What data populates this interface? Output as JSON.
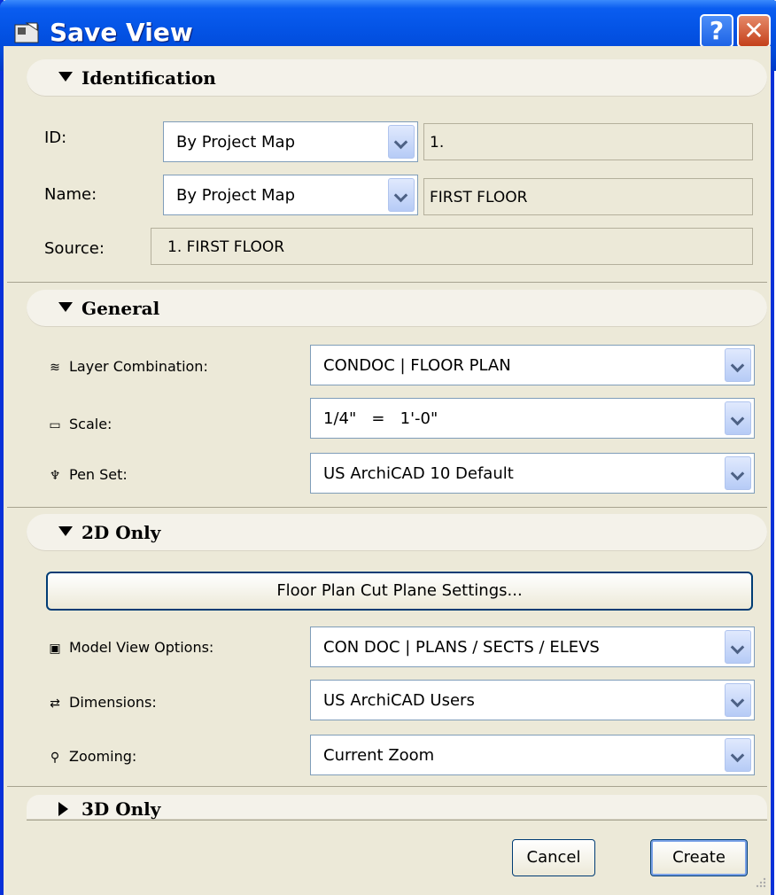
{
  "window": {
    "title": "Save View",
    "help_label": "?",
    "close_label": "✕"
  },
  "identification": {
    "header": "Identification",
    "id_label": "ID:",
    "id_mode": "By Project Map",
    "id_value": "1.",
    "name_label": "Name:",
    "name_mode": "By Project Map",
    "name_value": "FIRST FLOOR",
    "source_label": "Source:",
    "source_value": "1. FIRST FLOOR"
  },
  "general": {
    "header": "General",
    "layer_label": "Layer Combination:",
    "layer_value": "CONDOC | FLOOR PLAN",
    "scale_label": "Scale:",
    "scale_value": "1/4\"   =   1'-0\"",
    "pen_label": "Pen Set:",
    "pen_value": "US ArchiCAD 10 Default"
  },
  "two_d": {
    "header": "2D Only",
    "cut_plane_button": "Floor Plan Cut Plane Settings...",
    "mvo_label": "Model View Options:",
    "mvo_value": "CON DOC | PLANS / SECTS / ELEVS",
    "dim_label": "Dimensions:",
    "dim_value": "US ArchiCAD Users",
    "zoom_label": "Zooming:",
    "zoom_value": "Current Zoom"
  },
  "three_d": {
    "header": "3D Only"
  },
  "buttons": {
    "cancel": "Cancel",
    "create": "Create"
  },
  "icons": {
    "layer": "layers-icon",
    "scale": "ruler-icon",
    "pen": "pen-icon",
    "mvo": "model-view-icon",
    "dim": "dimension-icon",
    "zoom": "magnifier-icon"
  }
}
